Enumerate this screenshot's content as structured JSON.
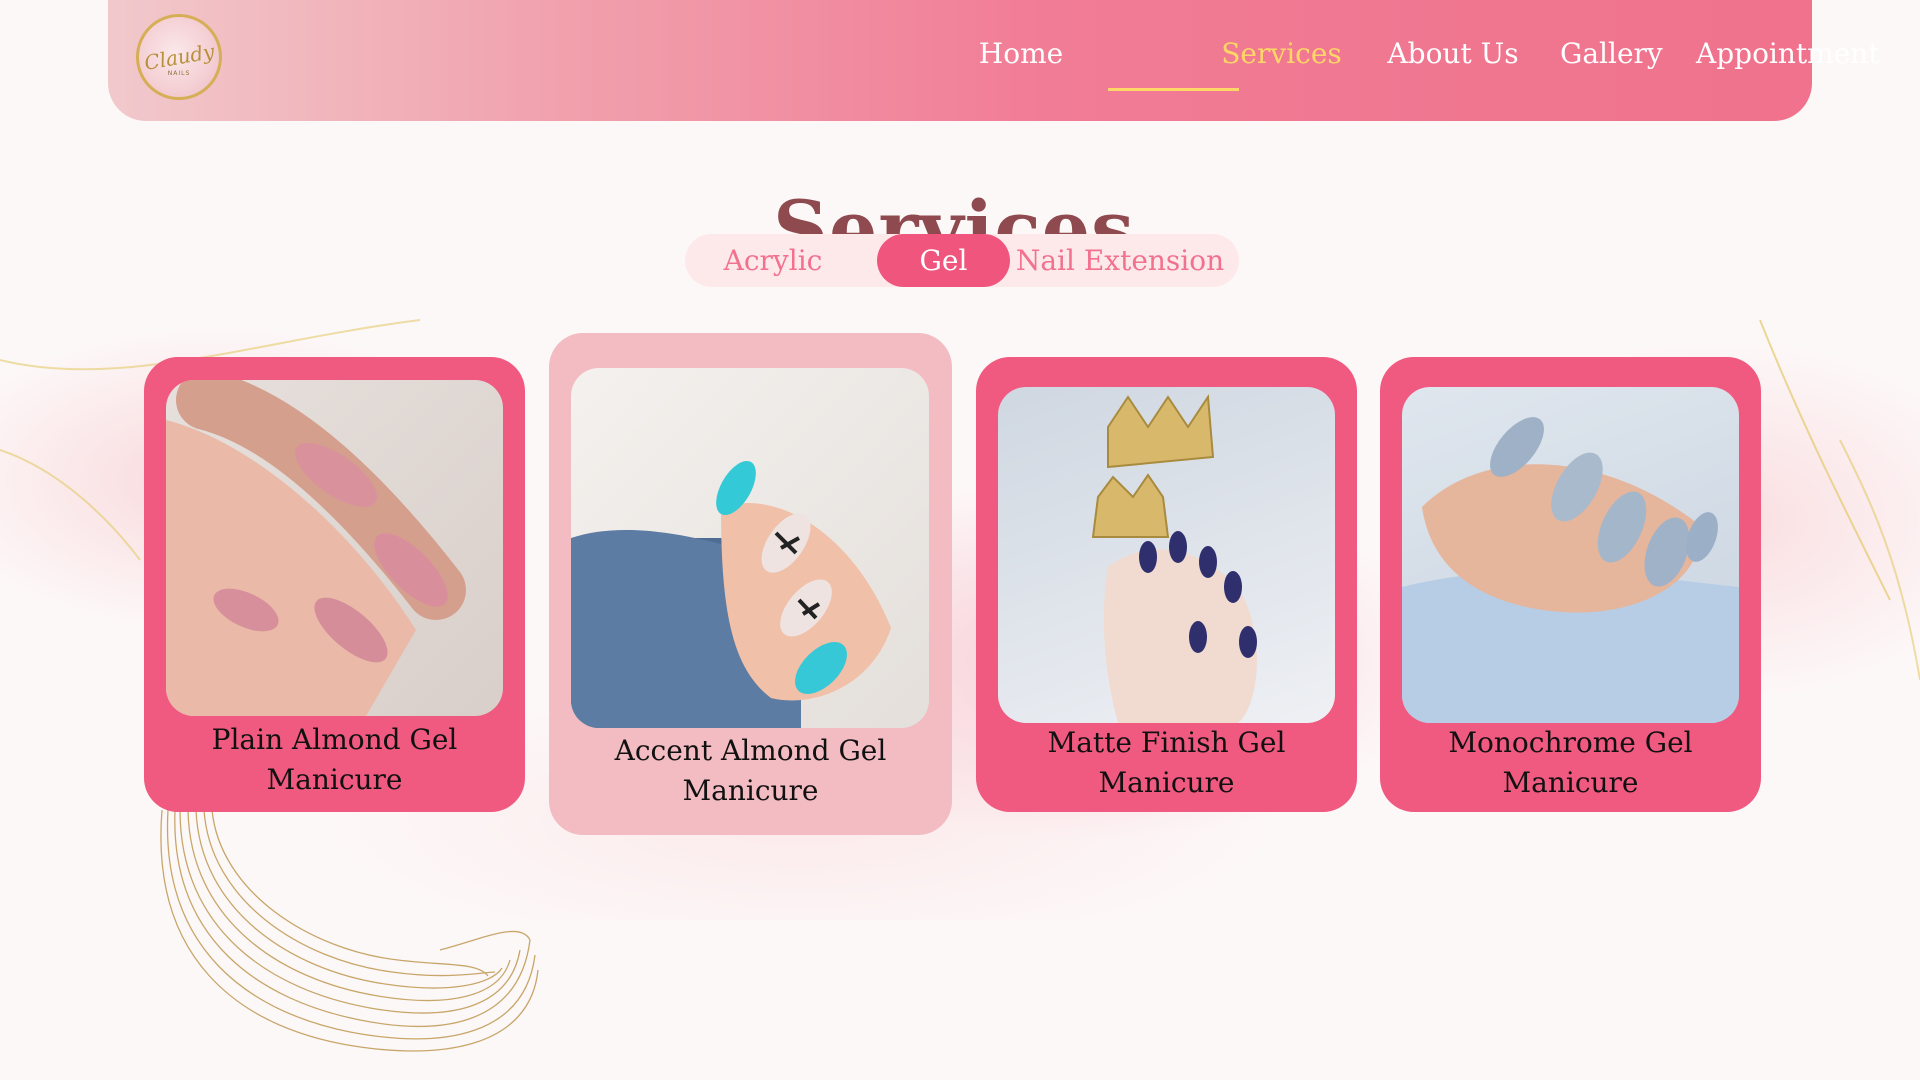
{
  "nav": {
    "logo_text": "Claudy",
    "logo_subtext": "NAILS",
    "items": [
      {
        "label": "Home"
      },
      {
        "label": "Services"
      },
      {
        "label": "About Us"
      },
      {
        "label": "Gallery"
      },
      {
        "label": "Appointment"
      }
    ],
    "active": "Services"
  },
  "page": {
    "title": "Services"
  },
  "tabs": {
    "items": [
      {
        "label": "Acrylic"
      },
      {
        "label": "Gel"
      },
      {
        "label": "Nail Extension"
      }
    ],
    "active": "Gel"
  },
  "cards": [
    {
      "line1": "Plain Almond Gel",
      "line2": "Manicure"
    },
    {
      "line1": "Accent Almond Gel",
      "line2": "Manicure"
    },
    {
      "line1": "Matte Finish Gel",
      "line2": "Manicure"
    },
    {
      "line1": "Monochrome Gel",
      "line2": "Manicure"
    }
  ],
  "colors": {
    "nav_gradient_start": "#f1c9cc",
    "nav_gradient_end": "#f0728c",
    "active_nav": "#ffd766",
    "title": "#8e4a4e",
    "card_pink": "#f05a80",
    "card_highlight": "#f2bcc2"
  }
}
